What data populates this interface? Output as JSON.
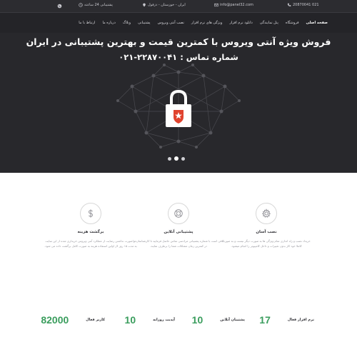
{
  "topbar": {
    "phone": "021 20870041",
    "email": "info@panel32.com",
    "address": "ایران - خوزستان - دزفول",
    "support": "پشتیبانی 24 ساعته"
  },
  "nav": {
    "items": [
      {
        "label": "صفحه اصلی"
      },
      {
        "label": "فروشگاه"
      },
      {
        "label": "پنل نمایندگی"
      },
      {
        "label": "دانلود نرم افزار"
      },
      {
        "label": "ویژگی های نرم افزار"
      },
      {
        "label": "نصب آنتی ویروس"
      },
      {
        "label": "پشتیبانی"
      },
      {
        "label": "وبلاگ"
      },
      {
        "label": "درباره ما"
      },
      {
        "label": "ارتباط با ما"
      }
    ]
  },
  "hero": {
    "title": "فروش ویژه آنتی ویروس با کمترین قیمت و بهترین پشتیبانی در ایران",
    "subtitle": "شماره تماس : ۲۲۸۷۰۰۴۱-۰۲۱",
    "slide_count": 3,
    "active_slide": 2
  },
  "features": [
    {
      "icon": "gear-icon",
      "title": "نصب آسان",
      "text": "خریداد نصب و راه اندازی تمام ویژگی ها به صورت دیگر نیست و به صورت کاملا خود کار بدون تغییرات و داخل کامپیوتر را انجام میشود."
    },
    {
      "icon": "lifebuoy-icon",
      "title": "پشتیبانی آنلاین",
      "text": "کافی است با شماره پشتیبانی مرادسی تماس حاصل فرمایید تا کارشناسان ما در کمترین زمان مشکلات شما را برطرف نمایند."
    },
    {
      "icon": "dollar-icon",
      "title": "برگشت هزینه",
      "text": "در صورت نداشتن رضایت از عملکرد آنتی ویروس خریداری شده از این سایت به مدت ۱۵ روز لاز اولین استفاده هزینه به صورت کامل برگشت داده می شود."
    }
  ],
  "stats": [
    {
      "label": "نرم افزار فعال",
      "value": "17"
    },
    {
      "label": "پشتیبان آنلاین",
      "value": "10"
    },
    {
      "label": "آپدیت روزانه",
      "value": "10"
    },
    {
      "label": "کاربر فعال",
      "value": "82000"
    }
  ],
  "colors": {
    "accent": "#3a9d5d",
    "hero_bg": "#28282c",
    "lock_badge": "#e0432e"
  }
}
